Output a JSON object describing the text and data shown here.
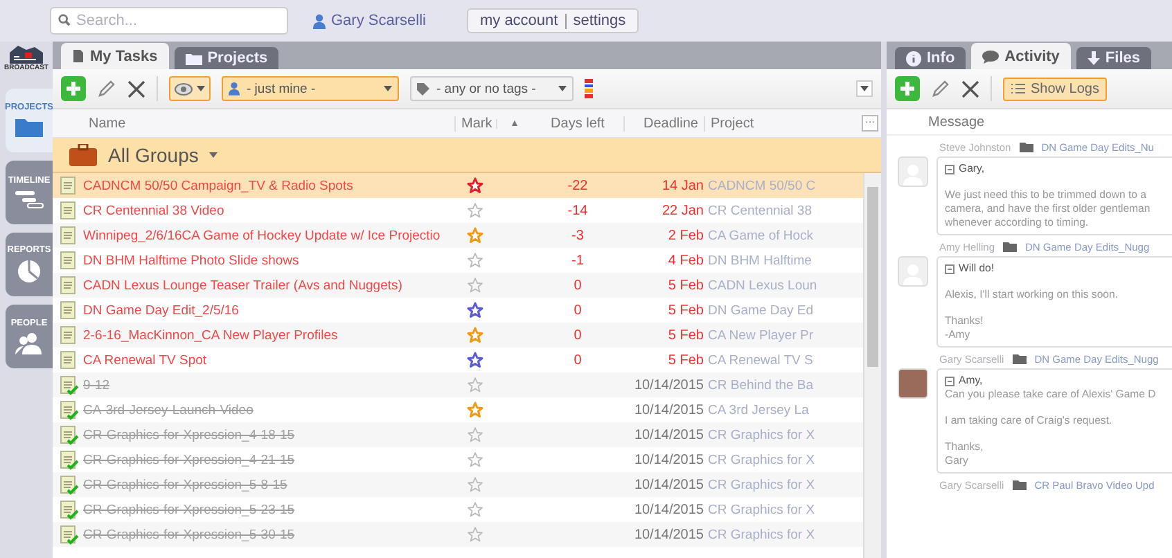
{
  "top_bar": {
    "search": {
      "placeholder": "Search..."
    },
    "user": "Gary Scarselli",
    "links": [
      "my account",
      "settings"
    ]
  },
  "logo": {
    "caption": "BROADCAST"
  },
  "nav": [
    {
      "label": "PROJECTS",
      "kind": "folder",
      "selected": true
    },
    {
      "label": "TIMELINE",
      "kind": "timeline",
      "selected": false
    },
    {
      "label": "REPORTS",
      "kind": "pie",
      "selected": false
    },
    {
      "label": "PEOPLE",
      "kind": "people",
      "selected": false
    }
  ],
  "tasks_panel": {
    "tabs": [
      {
        "label": "My Tasks",
        "kind": "page",
        "selected": true
      },
      {
        "label": "Projects",
        "kind": "folder",
        "selected": false
      }
    ],
    "toolbar": {
      "view_filter_on": true,
      "owner_filter": "- just mine -",
      "tag_filter": "- any or no tags -"
    },
    "columns": [
      "Name",
      "Mark",
      "▲",
      "Days left",
      "Deadline",
      "Project",
      "···"
    ],
    "group": "All Groups",
    "tasks": [
      {
        "name": "CADNCM 50/50 Campaign_TV & Radio Spots",
        "starred": true,
        "color": "#e0202a",
        "days_left": "-22",
        "deadline": "14 Jan",
        "project": "CADNCM 50/50 C",
        "overdue": true,
        "completed": false,
        "selected": true
      },
      {
        "name": "CR Centennial 38 Video",
        "starred": false,
        "days_left": "-14",
        "deadline": "22 Jan",
        "project": "CR Centennial 38",
        "overdue": true,
        "completed": false,
        "selected": false
      },
      {
        "name": "Winnipeg_2/6/16CA Game of Hockey Update w/ Ice Projectio",
        "starred": true,
        "color": "#f29a16",
        "days_left": "-3",
        "deadline": "2 Feb",
        "project": "CA Game of Hock",
        "overdue": true,
        "completed": false,
        "selected": false
      },
      {
        "name": "DN BHM Halftime Photo Slide shows",
        "starred": false,
        "days_left": "-1",
        "deadline": "4 Feb",
        "project": "DN BHM Halftime",
        "overdue": true,
        "completed": false,
        "selected": false
      },
      {
        "name": "CADN Lexus Lounge Teaser Trailer (Avs and Nuggets)",
        "starred": false,
        "days_left": "0",
        "deadline": "5 Feb",
        "project": "CADN Lexus Loun",
        "overdue": true,
        "completed": false,
        "selected": false
      },
      {
        "name": "DN Game Day Edit_2/5/16",
        "starred": true,
        "color": "#5b5bd6",
        "days_left": "0",
        "deadline": "5 Feb",
        "project": "DN Game Day Ed",
        "overdue": true,
        "completed": false,
        "selected": false
      },
      {
        "name": "2-6-16_MacKinnon_CA New Player Profiles",
        "starred": true,
        "color": "#f29a16",
        "days_left": "0",
        "deadline": "5 Feb",
        "project": "CA New Player Pr",
        "overdue": true,
        "completed": false,
        "selected": false
      },
      {
        "name": "CA Renewal TV Spot",
        "starred": true,
        "color": "#5b5bd6",
        "days_left": "0",
        "deadline": "5 Feb",
        "project": "CA Renewal TV S",
        "overdue": true,
        "completed": false,
        "selected": false
      },
      {
        "name": "9-12",
        "starred": false,
        "deadline": "10/14/2015",
        "project": "CR Behind the Ba",
        "overdue": false,
        "completed": true,
        "selected": false
      },
      {
        "name": "CA-3rd-Jersey-Launch-Video",
        "starred": true,
        "color": "#f29a16",
        "deadline": "10/14/2015",
        "project": "CA 3rd Jersey La",
        "overdue": false,
        "completed": true,
        "selected": false
      },
      {
        "name": "CR-Graphics-for-Xpression_4-18-15",
        "starred": false,
        "deadline": "10/14/2015",
        "project": "CR Graphics for X",
        "overdue": false,
        "completed": true,
        "selected": false
      },
      {
        "name": "CR-Graphics-for-Xpression_4-21-15",
        "starred": false,
        "deadline": "10/14/2015",
        "project": "CR Graphics for X",
        "overdue": false,
        "completed": true,
        "selected": false
      },
      {
        "name": "CR-Graphics-for-Xpression_5-8-15",
        "starred": false,
        "deadline": "10/14/2015",
        "project": "CR Graphics for X",
        "overdue": false,
        "completed": true,
        "selected": false
      },
      {
        "name": "CR-Graphics-for-Xpression_5-23-15",
        "starred": false,
        "deadline": "10/14/2015",
        "project": "CR Graphics for X",
        "overdue": false,
        "completed": true,
        "selected": false
      },
      {
        "name": "CR-Graphics-for-Xpression_5-30-15",
        "starred": false,
        "deadline": "10/14/2015",
        "project": "CR Graphics for X",
        "overdue": false,
        "completed": true,
        "selected": false
      }
    ]
  },
  "activity_panel": {
    "tabs": [
      {
        "label": "Info",
        "kind": "info",
        "selected": false
      },
      {
        "label": "Activity",
        "kind": "chat",
        "selected": true
      },
      {
        "label": "Files",
        "kind": "download",
        "selected": false
      }
    ],
    "show_logs": {
      "label": "Show Logs",
      "on": true
    },
    "column": "Message",
    "messages": [
      {
        "author": "Steve Johnston",
        "project": "DN Game Day Edits_Nu",
        "kind": "silhouette",
        "paragraphs": [
          [
            "Gary,"
          ],
          [
            "We just need this to be trimmed down to a",
            "camera, and have the first older gentleman",
            "whenever according to timing."
          ]
        ]
      },
      {
        "author": "Amy Helling",
        "project": "DN Game Day Edits_Nugg",
        "kind": "silhouette",
        "paragraphs": [
          [
            "Will do!"
          ],
          [
            "Alexis, I'll start working on this soon."
          ],
          [
            "Thanks!",
            "-Amy"
          ]
        ]
      },
      {
        "author": "Gary Scarselli",
        "project": "DN Game Day Edits_Nugg",
        "kind": "photo",
        "paragraphs": [
          [
            "Amy,",
            "Can you please take care of Alexis' Game D"
          ],
          [
            "I am taking care of Craig's request."
          ],
          [
            "Thanks,",
            "Gary"
          ]
        ]
      },
      {
        "author": "Gary Scarselli",
        "project": "CR Paul Bravo Video Upd"
      }
    ]
  }
}
